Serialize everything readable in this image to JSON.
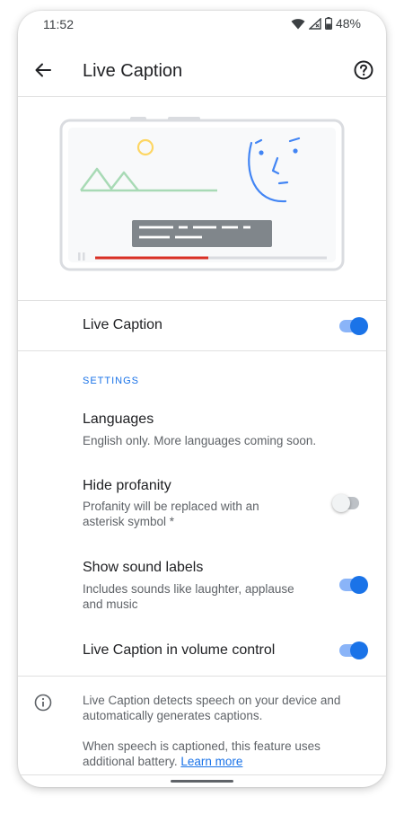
{
  "status_bar": {
    "time": "11:52",
    "battery": "48%"
  },
  "app_bar": {
    "title": "Live Caption"
  },
  "main_toggle": {
    "label": "Live Caption",
    "on": true
  },
  "settings": {
    "header": "SETTINGS",
    "languages": {
      "title": "Languages",
      "subtitle": "English only. More languages coming soon."
    },
    "hide_profanity": {
      "title": "Hide profanity",
      "subtitle": "Profanity will be replaced with an asterisk symbol *",
      "on": false
    },
    "sound_labels": {
      "title": "Show sound labels",
      "subtitle": "Includes sounds like laughter, applause and music",
      "on": true
    },
    "volume_control": {
      "title": "Live Caption in volume control",
      "on": true
    }
  },
  "footer": {
    "para1": "Live Caption detects speech on your device and automatically generates captions.",
    "para2": "When speech is captioned, this feature uses additional battery.",
    "learn_more": "Learn more"
  },
  "icons": {
    "back": "arrow-back-icon",
    "help": "help-circle-icon",
    "info": "info-icon",
    "wifi": "wifi-icon",
    "signal": "signal-icon",
    "battery": "battery-icon"
  },
  "colors": {
    "accent": "#1a73e8",
    "accent_light": "#8ab4f8",
    "progress": "#d93025"
  }
}
